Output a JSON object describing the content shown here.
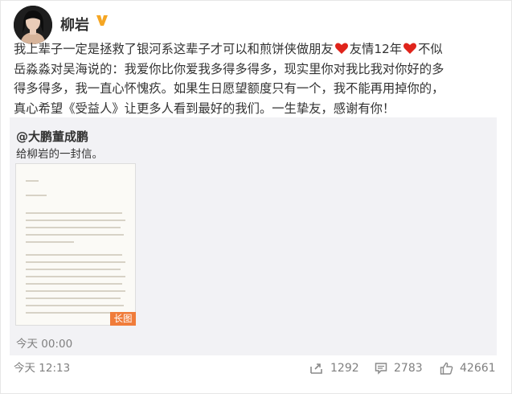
{
  "post": {
    "username": "柳岩",
    "text_line1": "我上辈子一定是拯救了银河系这辈子才可以和煎饼侠做朋友",
    "text_line1b": "友情12年",
    "text_line1c": "不似",
    "text_line2": "岳淼淼对吴海说的：我爱你比你爱我多得多得多，现实里你对我比我对你好的多",
    "text_line3": "得多得多，我一直心怀愧疚。如果生日愿望额度只有一个，我不能再用掉你的，",
    "text_line4": "真心希望《受益人》让更多人看到最好的我们。一生挚友，感谢有你！",
    "time": "今天 12:13"
  },
  "repost": {
    "author": "@大鹏董成鹏",
    "text": "给柳岩的一封信。",
    "image_tag": "长图",
    "time": "今天 00:00"
  },
  "actions": {
    "forward_count": "1292",
    "comment_count": "2783",
    "like_count": "42661"
  },
  "colors": {
    "verified": "#f5a623",
    "heart": "#e0241b",
    "long_tag": "#f07c3a",
    "repost_bg": "#f2f2f5",
    "meta_text": "#808080"
  },
  "icons": [
    "verified-icon",
    "heart-icon",
    "forward-icon",
    "comment-icon",
    "like-icon"
  ]
}
